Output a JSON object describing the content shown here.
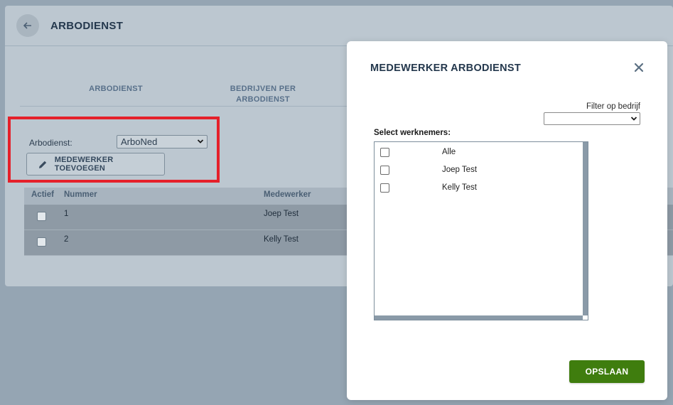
{
  "page": {
    "title": "ARBODIENST",
    "tabs": [
      {
        "label": "ARBODIENST"
      },
      {
        "label": "BEDRIJVEN PER ARBODIENST"
      }
    ],
    "form": {
      "arbodienst_label": "Arbodienst:",
      "arbodienst_value": "ArboNed",
      "add_button_label": "MEDEWERKER TOEVOEGEN"
    },
    "table": {
      "headers": {
        "actief": "Actief",
        "nummer": "Nummer",
        "medewerker": "Medewerker"
      },
      "rows": [
        {
          "nummer": "1",
          "medewerker": "Joep Test"
        },
        {
          "nummer": "2",
          "medewerker": "Kelly Test"
        }
      ]
    }
  },
  "modal": {
    "title": "MEDEWERKER ARBODIENST",
    "filter_label": "Filter op bedrijf",
    "filter_value": "",
    "select_label": "Select werknemers:",
    "items": [
      {
        "label": "Alle"
      },
      {
        "label": "Joep Test"
      },
      {
        "label": "Kelly Test"
      }
    ],
    "save_label": "OPSLAAN"
  },
  "colors": {
    "highlight_border": "#e5202a",
    "save_button": "#3f7d0e",
    "overlay": "#95a5b3"
  },
  "icons": {
    "back": "arrow-left-icon",
    "edit": "pencil-icon",
    "close": "close-icon",
    "dropdown": "chevron-down-icon"
  }
}
